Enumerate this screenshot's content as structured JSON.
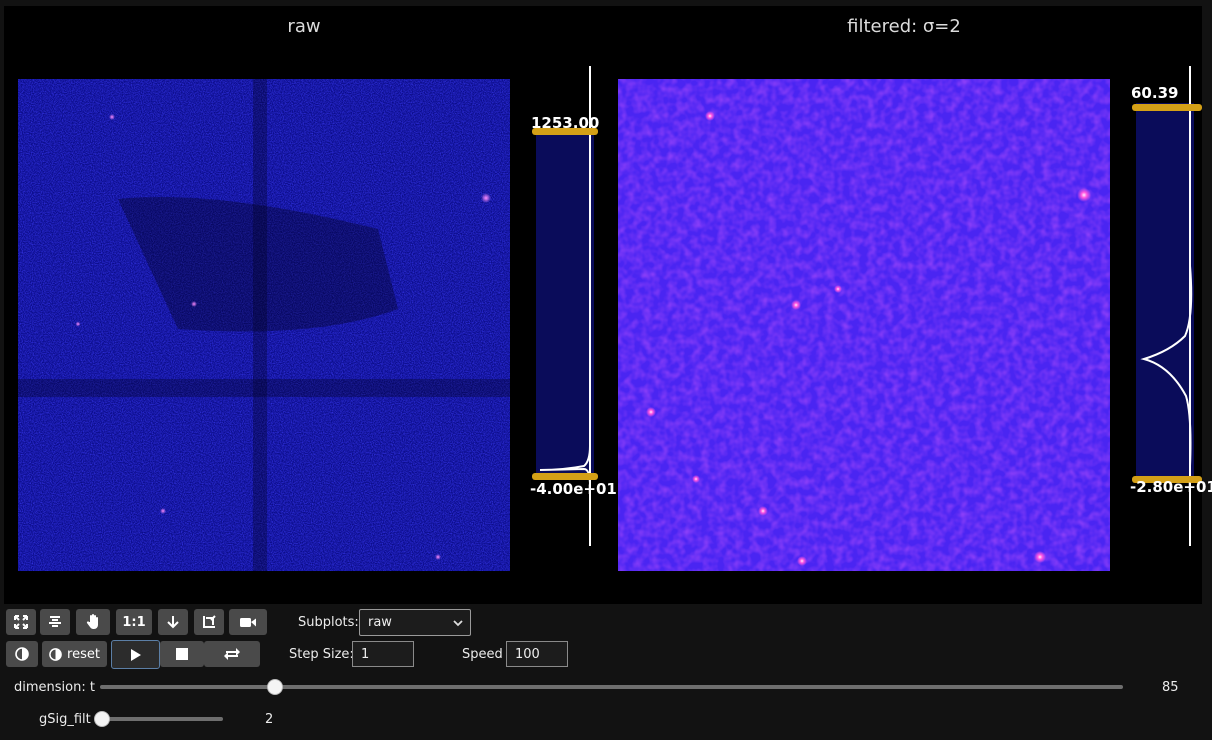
{
  "plots": {
    "left_title": "raw",
    "right_title": "filtered: σ=2",
    "left_lut": {
      "max_label": "1253.00",
      "min_label": "-4.00e+01"
    },
    "right_lut": {
      "max_label": "60.39",
      "min_label": "-2.80e+01"
    }
  },
  "toolbar": {
    "row1_icons": [
      "expand-icon",
      "center-icon",
      "hand-icon",
      "one-to-one",
      "arrow-down-icon",
      "crop-icon",
      "camera-icon"
    ],
    "one_to_one_label": "1:1",
    "contrast_reset_label": "reset",
    "subplots_label": "Subplots:",
    "subplots_value": "raw",
    "step_size_label": "Step Size:",
    "step_size_value": "1",
    "speed_label": "Speed",
    "speed_value": "100"
  },
  "sliders": {
    "dimension_label": "dimension: t",
    "dimension_value": "85",
    "dimension_fraction": 0.169,
    "gsig_label": "gSig_filt",
    "gsig_value": "2",
    "gsig_fraction": 0.0
  },
  "colors": {
    "raw_base": "#0b0c8a",
    "filtered_base": "#4a25f2",
    "lut_bar": "#0a0c5a",
    "handle": "#d4a017"
  }
}
